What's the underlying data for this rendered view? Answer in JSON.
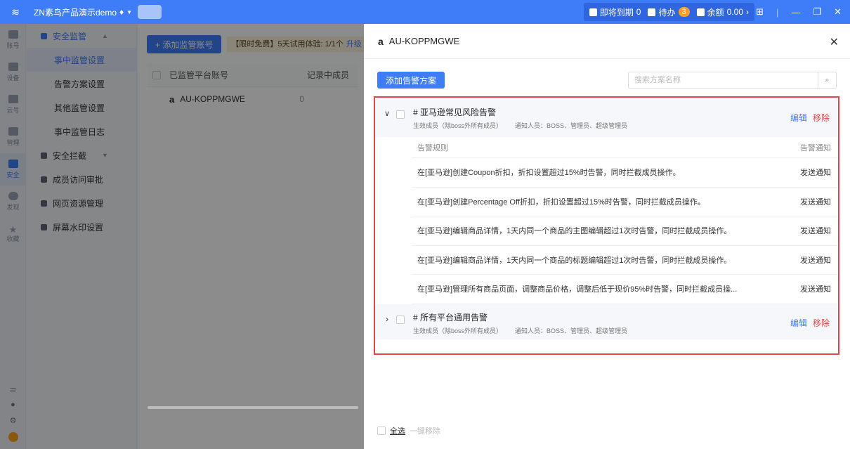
{
  "topbar": {
    "app_title": "ZN素鸟产品演示demo",
    "expiring_label": "即将到期",
    "expiring_count": "0",
    "todo_label": "待办",
    "todo_count": "3",
    "balance_label": "余额",
    "balance_value": "0.00",
    "accent": "#3f7cf7"
  },
  "rail": {
    "items": [
      {
        "label": "账号",
        "icon": "account-icon"
      },
      {
        "label": "设备",
        "icon": "device-icon"
      },
      {
        "label": "云号",
        "icon": "cloud-icon"
      },
      {
        "label": "管理",
        "icon": "manage-icon"
      },
      {
        "label": "安全",
        "icon": "security-icon"
      },
      {
        "label": "发现",
        "icon": "discover-icon"
      },
      {
        "label": "收藏",
        "icon": "star-icon"
      }
    ]
  },
  "subnav": {
    "group_security_monitor": "安全监管",
    "items_monitor": [
      "事中监管设置",
      "告警方案设置",
      "其他监管设置",
      "事中监管日志"
    ],
    "group_security_intercept": "安全拦截",
    "member_access": "成员访问审批",
    "web_resource": "网页资源管理",
    "watermark": "屏幕水印设置"
  },
  "main": {
    "add_button": "+ 添加监管账号",
    "promo_text": "【限时免费】5天试用体验: 1/1个",
    "promo_link": "升级",
    "col_account": "已监管平台账号",
    "col_members": "记录中成员",
    "row_account": "AU-KOPPMGWE",
    "row_members": "0"
  },
  "panel": {
    "title": "AU-KOPPMGWE",
    "add_plan_button": "添加告警方案",
    "search_placeholder": "搜索方案名称",
    "plan1": {
      "name": "# 亚马逊常见风险告警",
      "effective": "生效成员（除boss外所有成员）",
      "notify": "通知人员：BOSS、管理员、超级管理员",
      "edit": "编辑",
      "remove": "移除",
      "col_rule": "告警规则",
      "col_notice": "告警通知",
      "rules": [
        {
          "text": "在[亚马逊]创建Coupon折扣，折扣设置超过15%时告警，同时拦截成员操作。",
          "action": "发送通知"
        },
        {
          "text": "在[亚马逊]创建Percentage Off折扣，折扣设置超过15%时告警，同时拦截成员操作。",
          "action": "发送通知"
        },
        {
          "text": "在[亚马逊]编辑商品详情，1天内同一个商品的主图编辑超过1次时告警，同时拦截成员操作。",
          "action": "发送通知"
        },
        {
          "text": "在[亚马逊]编辑商品详情，1天内同一个商品的标题编辑超过1次时告警，同时拦截成员操作。",
          "action": "发送通知"
        },
        {
          "text": "在[亚马逊]管理所有商品页面，调整商品价格，调整后低于现价95%时告警，同时拦截成员操...",
          "action": "发送通知"
        }
      ]
    },
    "plan2": {
      "name": "# 所有平台通用告警",
      "effective": "生效成员（除boss外所有成员）",
      "notify": "通知人员：BOSS、管理员、超级管理员",
      "edit": "编辑",
      "remove": "移除"
    },
    "footer": {
      "select_all": "全选",
      "remove_all": "一键移除"
    }
  }
}
